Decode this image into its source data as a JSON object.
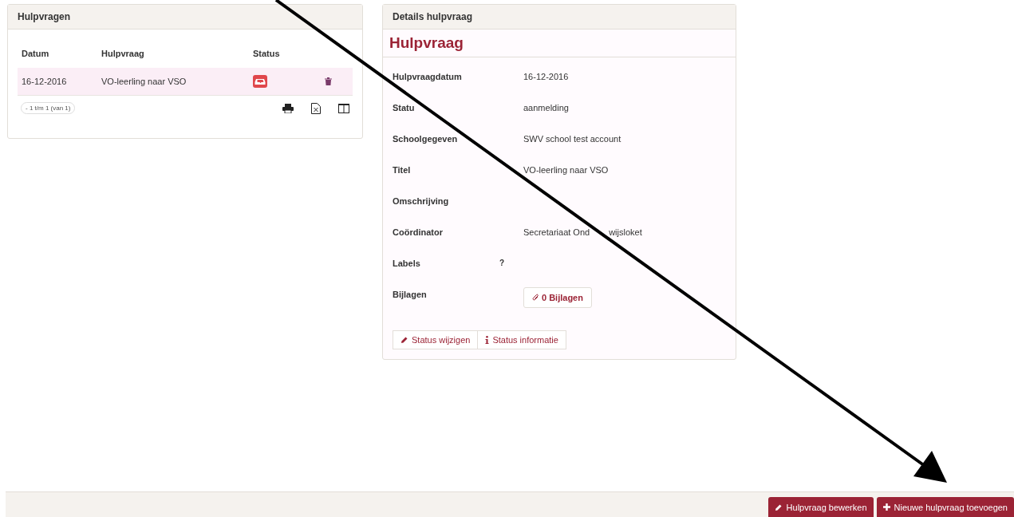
{
  "list_panel": {
    "title": "Hulpvragen",
    "columns": [
      "Datum",
      "Hulpvraag",
      "Status"
    ],
    "rows": [
      {
        "date": "16-12-2016",
        "title": "VO-leerling naar VSO",
        "selected": true
      }
    ],
    "pager": "- 1 t/m 1 (van 1)"
  },
  "details_panel": {
    "title": "Details hulpvraag",
    "heading": "Hulpvraag",
    "fields": [
      {
        "label": "Hulpvraagdatum",
        "value": "16-12-2016"
      },
      {
        "label": "Statu",
        "value": "aanmelding"
      },
      {
        "label": "Schoolgegeven",
        "value": "SWV school test account"
      },
      {
        "label": "Titel",
        "value": "VO-leerling naar VSO"
      },
      {
        "label": "Omschrijving"
      },
      {
        "label": "Coördinator",
        "value_parts": [
          "Secretariaat Ond",
          "wijsloket"
        ]
      },
      {
        "label": "Labels",
        "help": "?"
      },
      {
        "label": "Bijlagen",
        "button": "0 Bijlagen"
      }
    ],
    "actions": [
      {
        "kind": "edit",
        "label": "Status wijzigen"
      },
      {
        "kind": "info",
        "label": "Status informatie"
      }
    ]
  },
  "footer_buttons": [
    {
      "kind": "edit",
      "label": "Hulpvraag bewerken"
    },
    {
      "kind": "add",
      "label": "Nieuwe hulpvraag toevoegen"
    }
  ]
}
